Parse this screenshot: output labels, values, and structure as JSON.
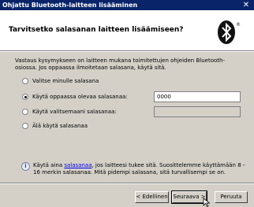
{
  "window": {
    "title": "Ohjattu Bluetooth-laitteen lisääminen"
  },
  "header": {
    "title": "Tarvitsetko salasanan laitteen lisäämiseen?"
  },
  "description": "Vastaus kysymykseen on laitteen mukana toimitettujen ohjeiden Bluetooth-osiossa. Jos oppaassa ilmoitetaan salasana, käytä sitä.",
  "options": [
    {
      "label": "Valitse minulle salasana",
      "checked": false
    },
    {
      "label": "Käytä oppaassa olevaa salasanaa:",
      "checked": true
    },
    {
      "label": "Käytä valitsemaani salasanaa:",
      "checked": false
    },
    {
      "label": "Älä käytä salasanaa",
      "checked": false
    }
  ],
  "fields": {
    "manual_passkey": "0000",
    "own_passkey": ""
  },
  "info": {
    "prefix": "Käytä aina ",
    "link": "salasanaa",
    "suffix": ", jos laitteesi tukee sitä. Suosittelemme käyttämään 8 - 16 merkin salasanaa. Mitä pidempi salasana, sitä turvallisempi se on."
  },
  "buttons": {
    "back": "< Edellinen",
    "next": "Seuraava >",
    "cancel": "Peruuta"
  },
  "colors": {
    "titlebar": "#0a246a",
    "face": "#d4d0c8"
  }
}
